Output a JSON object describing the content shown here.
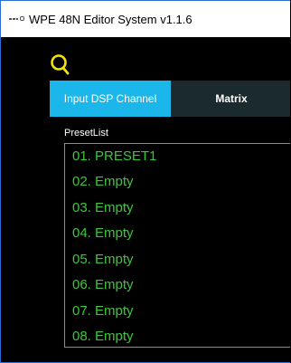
{
  "window": {
    "title": "WPE 48N Editor System v1.1.6",
    "icon": "app-logo-icon"
  },
  "toolbar": {
    "search_icon": "search-icon",
    "search_color": "#f2e30b"
  },
  "tabs": [
    {
      "label": "Input DSP Channel",
      "active": true
    },
    {
      "label": "Matrix",
      "active": false
    }
  ],
  "presets": {
    "label": "PresetList",
    "items": [
      "01. PRESET1",
      "02. Empty",
      "03. Empty",
      "04. Empty",
      "05. Empty",
      "06. Empty",
      "07. Empty",
      "08. Empty"
    ]
  },
  "colors": {
    "active_tab": "#1bb6ea",
    "inactive_tab": "#1b2b2d",
    "preset_text": "#3cc63c"
  }
}
